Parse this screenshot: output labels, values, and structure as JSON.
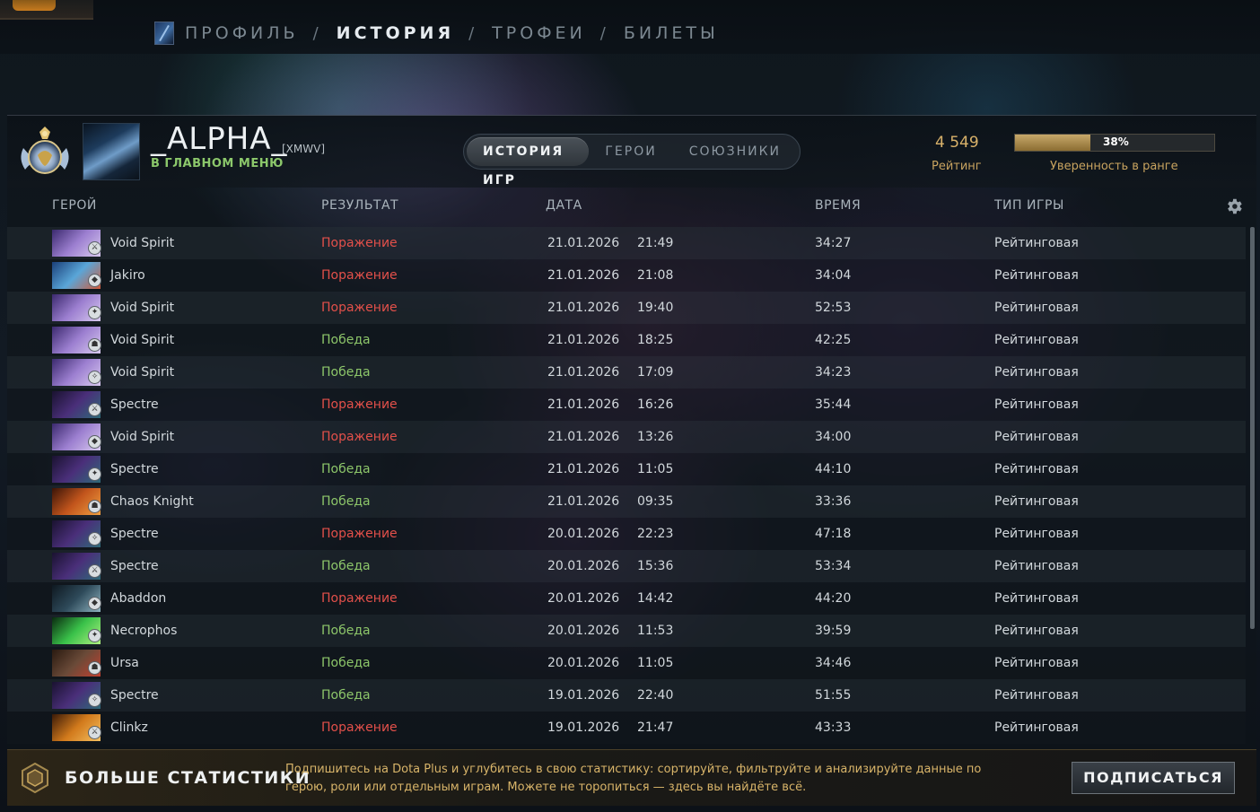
{
  "nav": {
    "items": [
      {
        "label": "ПРОФИЛЬ",
        "active": false
      },
      {
        "label": "ИСТОРИЯ",
        "active": true
      },
      {
        "label": "ТРОФЕИ",
        "active": false
      },
      {
        "label": "БИЛЕТЫ",
        "active": false
      }
    ],
    "separator": "/"
  },
  "player": {
    "name": "_ALPHA_",
    "tag": "[XMWV]",
    "status": "В ГЛАВНОМ МЕНЮ",
    "rank_icon": "rank-medal-icon",
    "avatar_icon": "player-avatar"
  },
  "tabs": [
    {
      "label": "ИСТОРИЯ ИГР",
      "active": true
    },
    {
      "label": "ГЕРОИ",
      "active": false
    },
    {
      "label": "СОЮЗНИКИ",
      "active": false
    }
  ],
  "stats": {
    "rating_value": "4 549",
    "rating_label": "Рейтинг",
    "confidence_percent": 38,
    "confidence_text": "38%",
    "confidence_label": "Уверенность в ранге"
  },
  "columns": {
    "hero": "ГЕРОЙ",
    "result": "РЕЗУЛЬТАТ",
    "date": "ДАТА",
    "duration": "ВРЕМЯ",
    "game_type": "ТИП ИГРЫ"
  },
  "matches": [
    {
      "hero": "Void Spirit",
      "result": "Поражение",
      "win": false,
      "date": "21.01.2026",
      "time": "21:49",
      "duration": "34:27",
      "type": "Рейтинговая"
    },
    {
      "hero": "Jakiro",
      "result": "Поражение",
      "win": false,
      "date": "21.01.2026",
      "time": "21:08",
      "duration": "34:04",
      "type": "Рейтинговая"
    },
    {
      "hero": "Void Spirit",
      "result": "Поражение",
      "win": false,
      "date": "21.01.2026",
      "time": "19:40",
      "duration": "52:53",
      "type": "Рейтинговая"
    },
    {
      "hero": "Void Spirit",
      "result": "Победа",
      "win": true,
      "date": "21.01.2026",
      "time": "18:25",
      "duration": "42:25",
      "type": "Рейтинговая"
    },
    {
      "hero": "Void Spirit",
      "result": "Победа",
      "win": true,
      "date": "21.01.2026",
      "time": "17:09",
      "duration": "34:23",
      "type": "Рейтинговая"
    },
    {
      "hero": "Spectre",
      "result": "Поражение",
      "win": false,
      "date": "21.01.2026",
      "time": "16:26",
      "duration": "35:44",
      "type": "Рейтинговая"
    },
    {
      "hero": "Void Spirit",
      "result": "Поражение",
      "win": false,
      "date": "21.01.2026",
      "time": "13:26",
      "duration": "34:00",
      "type": "Рейтинговая"
    },
    {
      "hero": "Spectre",
      "result": "Победа",
      "win": true,
      "date": "21.01.2026",
      "time": "11:05",
      "duration": "44:10",
      "type": "Рейтинговая"
    },
    {
      "hero": "Chaos Knight",
      "result": "Победа",
      "win": true,
      "date": "21.01.2026",
      "time": "09:35",
      "duration": "33:36",
      "type": "Рейтинговая"
    },
    {
      "hero": "Spectre",
      "result": "Поражение",
      "win": false,
      "date": "20.01.2026",
      "time": "22:23",
      "duration": "47:18",
      "type": "Рейтинговая"
    },
    {
      "hero": "Spectre",
      "result": "Победа",
      "win": true,
      "date": "20.01.2026",
      "time": "15:36",
      "duration": "53:34",
      "type": "Рейтинговая"
    },
    {
      "hero": "Abaddon",
      "result": "Поражение",
      "win": false,
      "date": "20.01.2026",
      "time": "14:42",
      "duration": "44:20",
      "type": "Рейтинговая"
    },
    {
      "hero": "Necrophos",
      "result": "Победа",
      "win": true,
      "date": "20.01.2026",
      "time": "11:53",
      "duration": "39:59",
      "type": "Рейтинговая"
    },
    {
      "hero": "Ursa",
      "result": "Победа",
      "win": true,
      "date": "20.01.2026",
      "time": "11:05",
      "duration": "34:46",
      "type": "Рейтинговая"
    },
    {
      "hero": "Spectre",
      "result": "Победа",
      "win": true,
      "date": "19.01.2026",
      "time": "22:40",
      "duration": "51:55",
      "type": "Рейтинговая"
    },
    {
      "hero": "Clinkz",
      "result": "Поражение",
      "win": false,
      "date": "19.01.2026",
      "time": "21:47",
      "duration": "43:33",
      "type": "Рейтинговая"
    }
  ],
  "hero_colors": {
    "Void Spirit": [
      "#3b2a6e",
      "#9c7fd0",
      "#d8c9ef"
    ],
    "Jakiro": [
      "#1b3f78",
      "#5aa6d8",
      "#d05a3a"
    ],
    "Spectre": [
      "#1a1230",
      "#4a2f7a",
      "#2e6a78"
    ],
    "Chaos Knight": [
      "#3a1408",
      "#c2551c",
      "#f0a040"
    ],
    "Abaddon": [
      "#0e1820",
      "#2e4a5a",
      "#8fb4c0"
    ],
    "Necrophos": [
      "#0a2a10",
      "#3ac24a",
      "#b0f080"
    ],
    "Ursa": [
      "#2a1a10",
      "#6a4a38",
      "#c04030"
    ],
    "Clinkz": [
      "#3a1a08",
      "#d27a1c",
      "#f4c060"
    ]
  },
  "colors": {
    "win": "#8dc66a",
    "loss": "#e3504a",
    "gold": "#d9b26a"
  },
  "footer": {
    "title": "БОЛЬШЕ СТАТИСТИКИ",
    "text": "Подпишитесь на Dota Plus и углубитесь в свою статистику: сортируйте, фильтруйте и анализируйте данные по герою, роли или отдельным играм. Можете не торопиться — здесь вы найдёте всё.",
    "button": "ПОДПИСАТЬСЯ"
  }
}
